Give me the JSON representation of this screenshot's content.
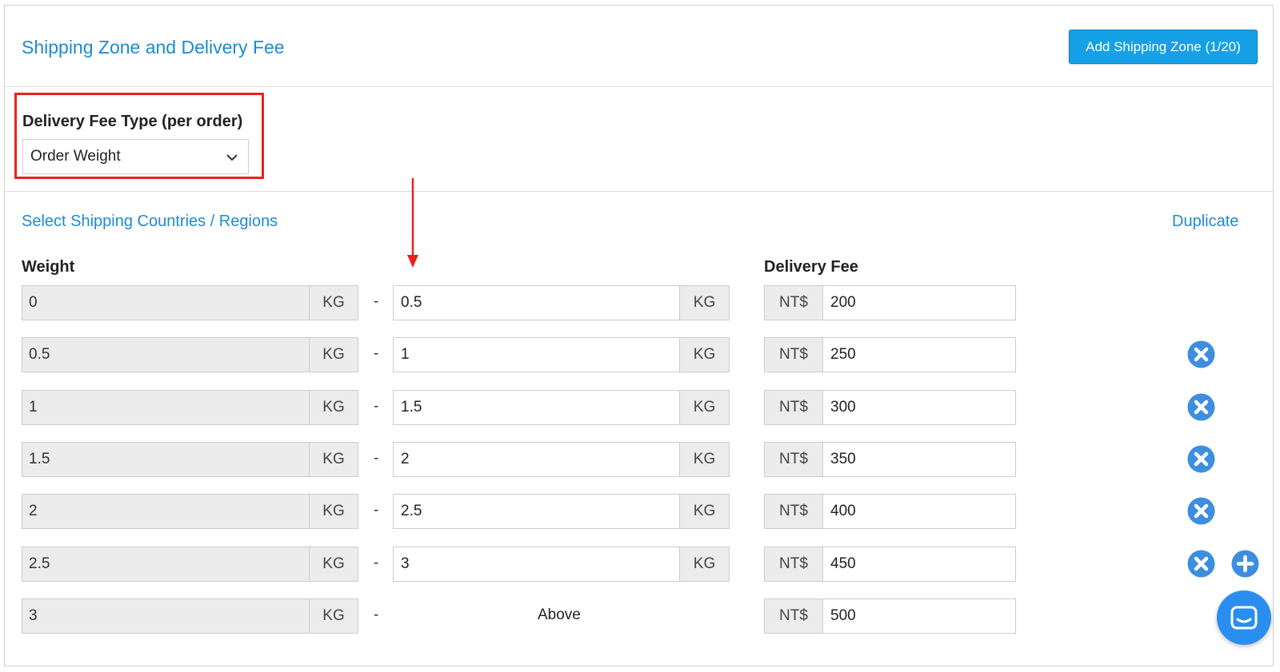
{
  "header": {
    "title": "Shipping Zone and Delivery Fee",
    "add_button": "Add Shipping Zone (1/20)"
  },
  "fee_type": {
    "label": "Delivery Fee Type (per order)",
    "selected": "Order Weight"
  },
  "links": {
    "countries": "Select Shipping Countries / Regions",
    "duplicate": "Duplicate"
  },
  "columns": {
    "weight": "Weight",
    "fee": "Delivery Fee"
  },
  "unit": "KG",
  "currency": "NT$",
  "dash": "-",
  "above": "Above",
  "rows": [
    {
      "from": "0",
      "to": "0.5",
      "fee": "200"
    },
    {
      "from": "0.5",
      "to": "1",
      "fee": "250"
    },
    {
      "from": "1",
      "to": "1.5",
      "fee": "300"
    },
    {
      "from": "1.5",
      "to": "2",
      "fee": "350"
    },
    {
      "from": "2",
      "to": "2.5",
      "fee": "400"
    },
    {
      "from": "2.5",
      "to": "3",
      "fee": "450"
    },
    {
      "from": "3",
      "to": "",
      "fee": "500"
    }
  ],
  "icons": {
    "dropdown": "chevron-down-icon",
    "remove": "remove-circle-icon",
    "add": "add-circle-icon",
    "chat": "chat-icon",
    "annotation_arrow": "arrow-down-icon"
  },
  "colors": {
    "link": "#1f8ad2",
    "button": "#16a0e6",
    "highlight": "#e8231e",
    "icon": "#3d8ee0",
    "chat": "#2a8ef0"
  }
}
